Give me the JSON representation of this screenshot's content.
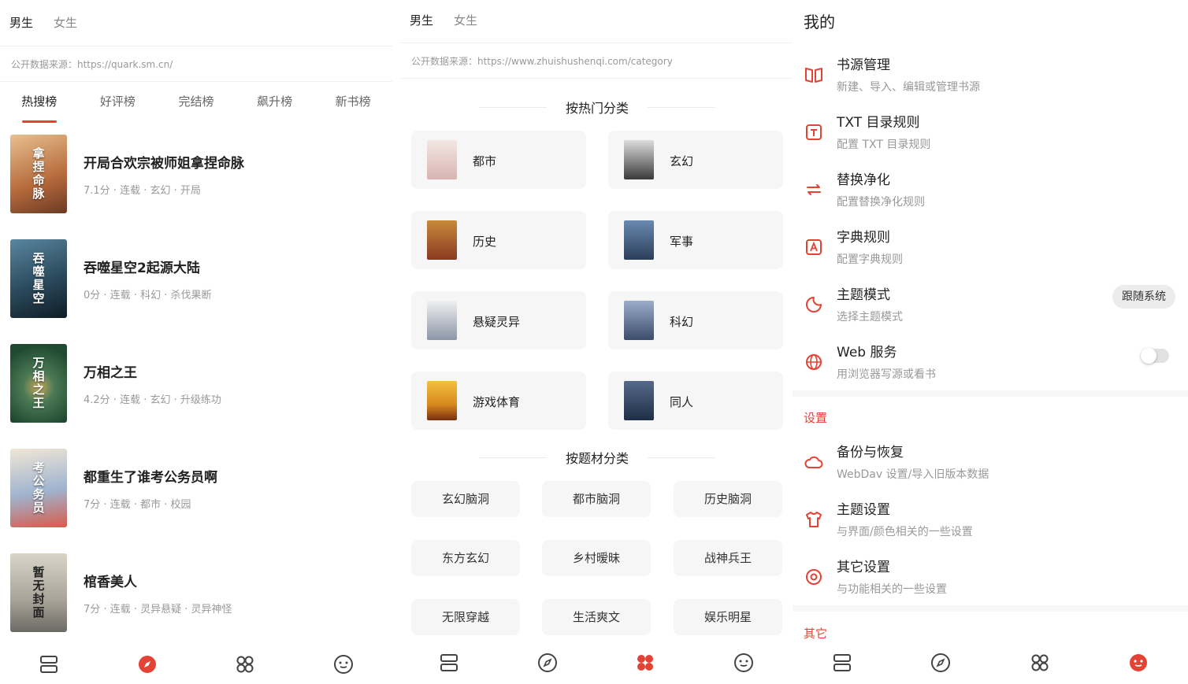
{
  "colors": {
    "accent": "#e34334",
    "text": "#222222",
    "muted": "#999999",
    "card": "#f6f6f6"
  },
  "p1": {
    "gender_tabs": [
      "男生",
      "女生"
    ],
    "source": "公开数据来源：https://quark.sm.cn/",
    "rank_tabs": [
      "热搜榜",
      "好评榜",
      "完结榜",
      "飙升榜",
      "新书榜"
    ],
    "books": [
      {
        "title": "开局合欢宗被师姐拿捏命脉",
        "meta": "7.1分 · 连载 · 玄幻 · 开局",
        "cover_text": "拿捏命脉",
        "cover_color": "#b5693b"
      },
      {
        "title": "吞噬星空2起源大陆",
        "meta": "0分 · 连载 · 科幻 · 杀伐果断",
        "cover_text": "吞噬星空",
        "cover_color": "#2a4a5c"
      },
      {
        "title": "万相之王",
        "meta": "4.2分 · 连载 · 玄幻 · 升级练功",
        "cover_text": "万相之王",
        "cover_color": "#2f6a46"
      },
      {
        "title": "都重生了谁考公务员啊",
        "meta": "7分 · 连载 · 都市 · 校园",
        "cover_text": "考公务员",
        "cover_color": "#7a8fb0"
      },
      {
        "title": "棺香美人",
        "meta": "7分 · 连载 · 灵异悬疑 · 灵异神怪",
        "cover_text": "暂无封面",
        "cover_color": "#8c8a84"
      }
    ]
  },
  "p2": {
    "gender_tabs": [
      "男生",
      "女生"
    ],
    "source": "公开数据来源：https://www.zhuishushenqi.com/category",
    "hot_title": "按热门分类",
    "hot": [
      {
        "label": "都市",
        "color": "#d8b4b0"
      },
      {
        "label": "玄幻",
        "color": "#3a3a3a"
      },
      {
        "label": "历史",
        "color": "#8a3a22"
      },
      {
        "label": "军事",
        "color": "#2b3e5a"
      },
      {
        "label": "悬疑灵异",
        "color": "#8c96a6"
      },
      {
        "label": "科幻",
        "color": "#3c4c6a"
      },
      {
        "label": "游戏体育",
        "color": "#d6891e"
      },
      {
        "label": "同人",
        "color": "#1e2e46"
      }
    ],
    "topic_title": "按题材分类",
    "topics": [
      "玄幻脑洞",
      "都市脑洞",
      "历史脑洞",
      "东方玄幻",
      "乡村暧昧",
      "战神兵王",
      "无限穿越",
      "生活爽文",
      "娱乐明星"
    ]
  },
  "p3": {
    "title": "我的",
    "items": [
      {
        "title": "书源管理",
        "sub": "新建、导入、编辑或管理书源",
        "icon": "book-open-icon"
      },
      {
        "title": "TXT 目录规则",
        "sub": "配置 TXT 目录规则",
        "icon": "txt-icon"
      },
      {
        "title": "替换净化",
        "sub": "配置替换净化规则",
        "icon": "swap-icon"
      },
      {
        "title": "字典规则",
        "sub": "配置字典规则",
        "icon": "dictionary-icon"
      },
      {
        "title": "主题模式",
        "sub": "选择主题模式",
        "icon": "theme-icon",
        "pill": "跟随系统"
      },
      {
        "title": "Web 服务",
        "sub": "用浏览器写源或看书",
        "icon": "globe-icon"
      }
    ],
    "settings_head": "设置",
    "settings": [
      {
        "title": "备份与恢复",
        "sub": "WebDav 设置/导入旧版本数据",
        "icon": "cloud-icon"
      },
      {
        "title": "主题设置",
        "sub": "与界面/颜色相关的一些设置",
        "icon": "shirt-icon"
      },
      {
        "title": "其它设置",
        "sub": "与功能相关的一些设置",
        "icon": "settings-icon"
      }
    ],
    "other_head": "其它"
  }
}
